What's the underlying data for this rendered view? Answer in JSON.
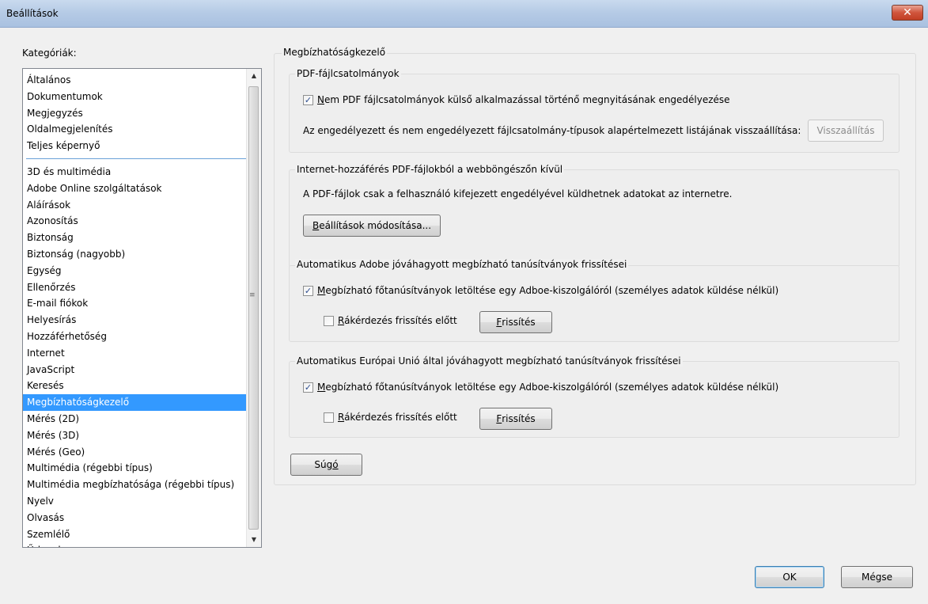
{
  "window": {
    "title": "Beállítások",
    "close_icon": "close-icon"
  },
  "categories": {
    "label": "Kategóriák:",
    "top_items": [
      "Általános",
      "Dokumentumok",
      "Megjegyzés",
      "Oldalmegjelenítés",
      "Teljes képernyő"
    ],
    "items": [
      "3D és multimédia",
      "Adobe Online szolgáltatások",
      "Aláírások",
      "Azonosítás",
      "Biztonság",
      "Biztonság (nagyobb)",
      "Egység",
      "Ellenőrzés",
      "E-mail fiókok",
      "Helyesírás",
      "Hozzáférhetőség",
      "Internet",
      "JavaScript",
      "Keresés",
      "Megbízhatóságkezelő",
      "Mérés (2D)",
      "Mérés (3D)",
      "Mérés (Geo)",
      "Multimédia (régebbi típus)",
      "Multimédia megbízhatósága (régebbi típus)",
      "Nyelv",
      "Olvasás",
      "Szemlélő",
      "Űrlapok"
    ],
    "selected": "Megbízhatóságkezelő"
  },
  "panel": {
    "title": "Megbízhatóságkezelő",
    "pdf_attachments": {
      "title": "PDF-fájlcsatolmányok",
      "allow_checkbox_label_accel": "N",
      "allow_checkbox_label_rest": "em PDF fájlcsatolmányok külső alkalmazással történő megnyitásának engedélyezése",
      "allow_checked": true,
      "reset_text": "Az engedélyezett és nem engedélyezett fájlcsatolmány-típusok alapértelmezett listájának visszaállítása:",
      "reset_button": "Visszaállítás"
    },
    "internet_access": {
      "title": "Internet-hozzáférés PDF-fájlokból a webböngészőn kívül",
      "description": "A PDF-fájlok csak a felhasználó kifejezett engedélyével küldhetnek adatokat az internetre.",
      "change_button_accel": "B",
      "change_button_rest": "eállítások módosítása..."
    },
    "adobe_certs": {
      "title": "Automatikus Adobe jóváhagyott megbízható tanúsítványok frissítései",
      "download_label_accel": "M",
      "download_label_rest": "egbízható főtanúsítványok letöltése egy Adboe-kiszolgálóról (személyes adatok küldése nélkül)",
      "download_checked": true,
      "ask_label_accel": "R",
      "ask_label_rest": "ákérdezés frissítés előtt",
      "ask_checked": false,
      "update_button_accel": "F",
      "update_button_rest": "rissítés"
    },
    "eu_certs": {
      "title": "Automatikus Európai Unió által jóváhagyott megbízható tanúsítványok frissítései",
      "download_label_accel": "M",
      "download_label_rest": "egbízható főtanúsítványok letöltése egy Adboe-kiszolgálóról (személyes adatok küldése nélkül)",
      "download_checked": true,
      "ask_label_accel": "R",
      "ask_label_rest": "ákérdezés frissítés előtt",
      "ask_checked": false,
      "update_button_accel": "F",
      "update_button_rest": "rissítés"
    },
    "help_button_pre": "Súg",
    "help_button_accel": "ó"
  },
  "footer": {
    "ok_button": "OK",
    "cancel_button": "Mégse"
  },
  "colors": {
    "selection": "#3399ff",
    "close_button": "#c13e24"
  }
}
